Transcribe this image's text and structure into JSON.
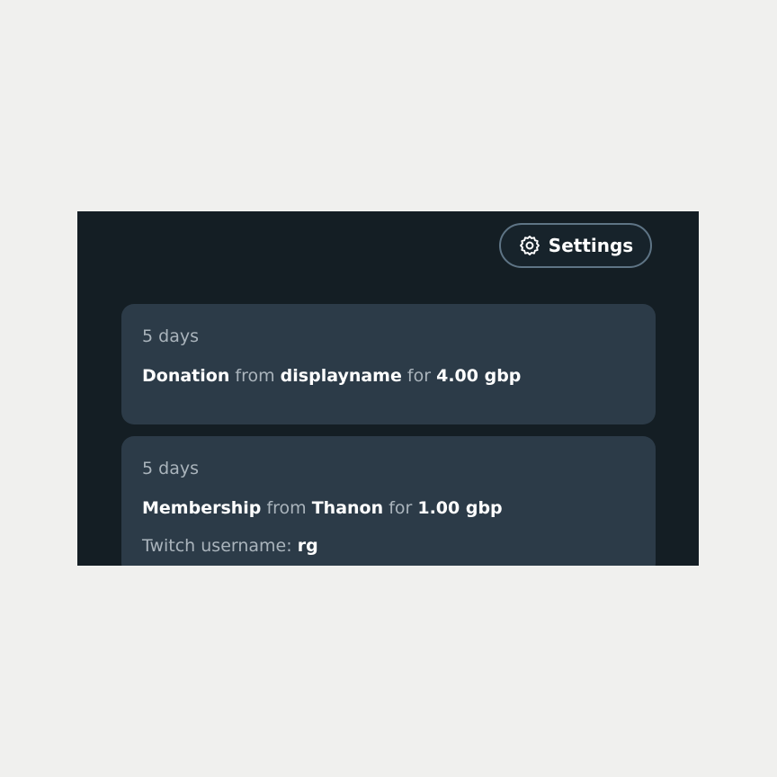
{
  "toolbar": {
    "settings_label": "Settings",
    "settings_icon": "gear-icon"
  },
  "events": [
    {
      "time": "5 days",
      "type": "Donation",
      "from_word": "from",
      "name": "displayname",
      "for_word": "for",
      "amount": "4.00 gbp"
    },
    {
      "time": "5 days",
      "type": "Membership",
      "from_word": "from",
      "name": "Thanon",
      "for_word": "for",
      "amount": "1.00 gbp",
      "extra_label": "Twitch username:",
      "extra_value": "rg"
    }
  ],
  "colors": {
    "page_background": "#f0f0ee",
    "panel_background": "#141e24",
    "card_background": "#2c3b48",
    "button_border": "#5e7485",
    "muted_text": "#aab4bc",
    "strong_text": "#ffffff"
  }
}
